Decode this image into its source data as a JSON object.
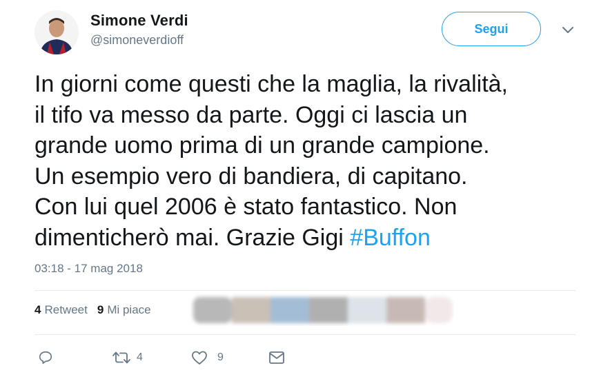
{
  "user": {
    "name": "Simone Verdi",
    "handle": "@simoneverdioff"
  },
  "follow": {
    "label": "Segui"
  },
  "tweet": {
    "lines": [
      "In giorni come questi che la maglia, la rivalità,",
      "il tifo va messo da parte. Oggi ci lascia un",
      "grande uomo prima di un grande campione.",
      "Un esempio vero di bandiera, di capitano.",
      "Con lui quel 2006 è stato fantastico. Non",
      "dimenticherò mai. Grazie Gigi "
    ],
    "hashtag": "#Buffon",
    "timestamp": "03:18 - 17 mag 2018"
  },
  "stats": {
    "retweet_count": "4",
    "retweet_label": "Retweet",
    "like_count": "9",
    "like_label": "Mi piace"
  },
  "actions": {
    "retweet_count": "4",
    "like_count": "9"
  },
  "colors": {
    "accent": "#1da1f2",
    "secondary_text": "#657786",
    "divider": "#e6ecf0"
  }
}
